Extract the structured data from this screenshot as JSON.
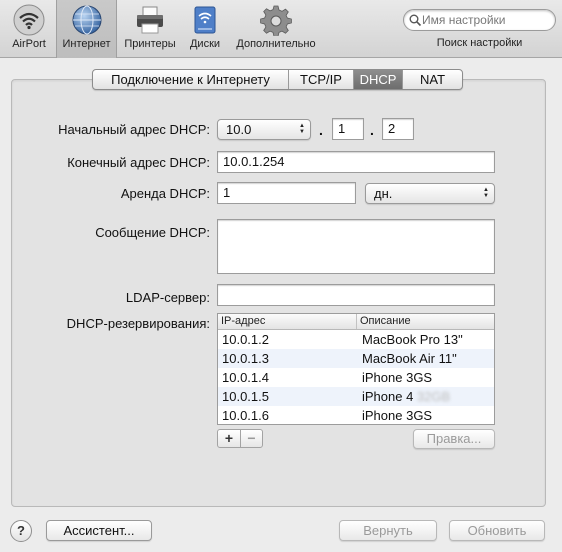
{
  "toolbar": {
    "items": [
      {
        "label": "AirPort",
        "icon": "wifi-icon"
      },
      {
        "label": "Интернет",
        "icon": "globe-icon"
      },
      {
        "label": "Принтеры",
        "icon": "printer-icon"
      },
      {
        "label": "Диски",
        "icon": "disk-icon"
      },
      {
        "label": "Дополнительно",
        "icon": "gear-icon"
      }
    ],
    "search_placeholder": "Имя настройки",
    "search_caption": "Поиск настройки"
  },
  "tabs": [
    {
      "label": "Подключение к Интернету",
      "active": false
    },
    {
      "label": "TCP/IP",
      "active": false
    },
    {
      "label": "DHCP",
      "active": true
    },
    {
      "label": "NAT",
      "active": false
    }
  ],
  "form": {
    "start_label": "Начальный адрес DHCP:",
    "start_prefix": "10.0",
    "start_octet3": "1",
    "start_octet4": "2",
    "end_label": "Конечный адрес DHCP:",
    "end_value": "10.0.1.254",
    "lease_label": "Аренда DHCP:",
    "lease_value": "1",
    "lease_unit": "дн.",
    "message_label": "Сообщение DHCP:",
    "message_value": "",
    "ldap_label": "LDAP-сервер:",
    "ldap_value": "",
    "reservations_label": "DHCP-резервирования:"
  },
  "reservations": {
    "columns": [
      "IP-адрес",
      "Описание"
    ],
    "rows": [
      {
        "ip": "10.0.1.2",
        "desc": "MacBook Pro 13\""
      },
      {
        "ip": "10.0.1.3",
        "desc": "MacBook Air 11\""
      },
      {
        "ip": "10.0.1.4",
        "desc": "iPhone 3GS"
      },
      {
        "ip": "10.0.1.5",
        "desc": "iPhone 4",
        "desc_blurred": "32GB"
      },
      {
        "ip": "10.0.1.6",
        "desc": "iPhone 3GS"
      }
    ],
    "add_label": "+",
    "remove_label": "−",
    "edit_label": "Правка..."
  },
  "footer": {
    "help_label": "?",
    "assistant_label": "Ассистент...",
    "revert_label": "Вернуть",
    "update_label": "Обновить"
  },
  "colors": {
    "active_tab": "#7d7d7d",
    "panel_bg": "#e3e3e3",
    "table_stripe": "#eef3fb"
  }
}
